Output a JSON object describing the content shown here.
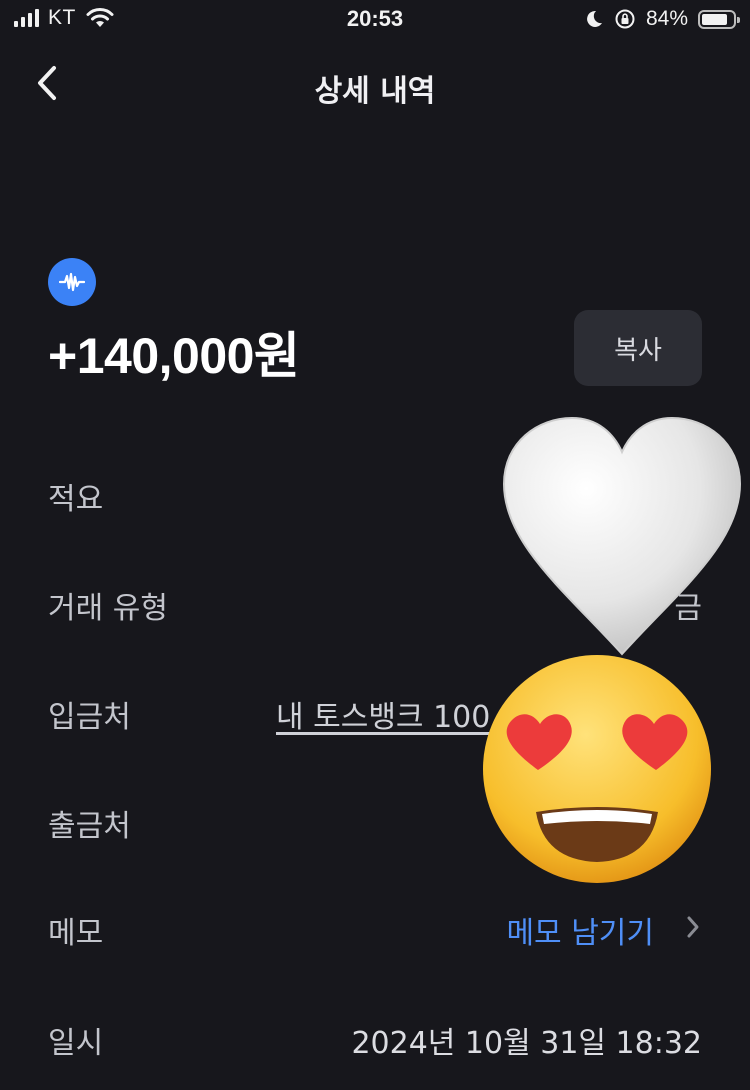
{
  "status_bar": {
    "carrier": "KT",
    "time": "20:53",
    "battery_percent": "84%",
    "battery_level": 0.84,
    "icons": [
      "signal-icon",
      "wifi-icon",
      "moon-icon",
      "orientation-lock-icon",
      "battery-icon"
    ]
  },
  "nav": {
    "title": "상세 내역",
    "back_icon": "chevron-left-icon"
  },
  "transaction": {
    "amount": "+140,000원",
    "copy_label": "복사",
    "bank_icon": "toss-bank-icon",
    "bank_color": "#3b82f6"
  },
  "details": [
    {
      "label": "적요",
      "value": ""
    },
    {
      "label": "거래 유형",
      "value": "금"
    },
    {
      "label": "입금처",
      "value": "내 토스뱅크 100"
    },
    {
      "label": "출금처",
      "value": ""
    },
    {
      "label": "메모",
      "value": "메모 남기기"
    },
    {
      "label": "일시",
      "value": "2024년 10월 31일 18:32"
    }
  ],
  "stickers": [
    "white-heart-emoji",
    "heart-eyes-emoji"
  ],
  "colors": {
    "background": "#17171c",
    "accent": "#4f8ff7",
    "button_bg": "#2c2d34"
  }
}
